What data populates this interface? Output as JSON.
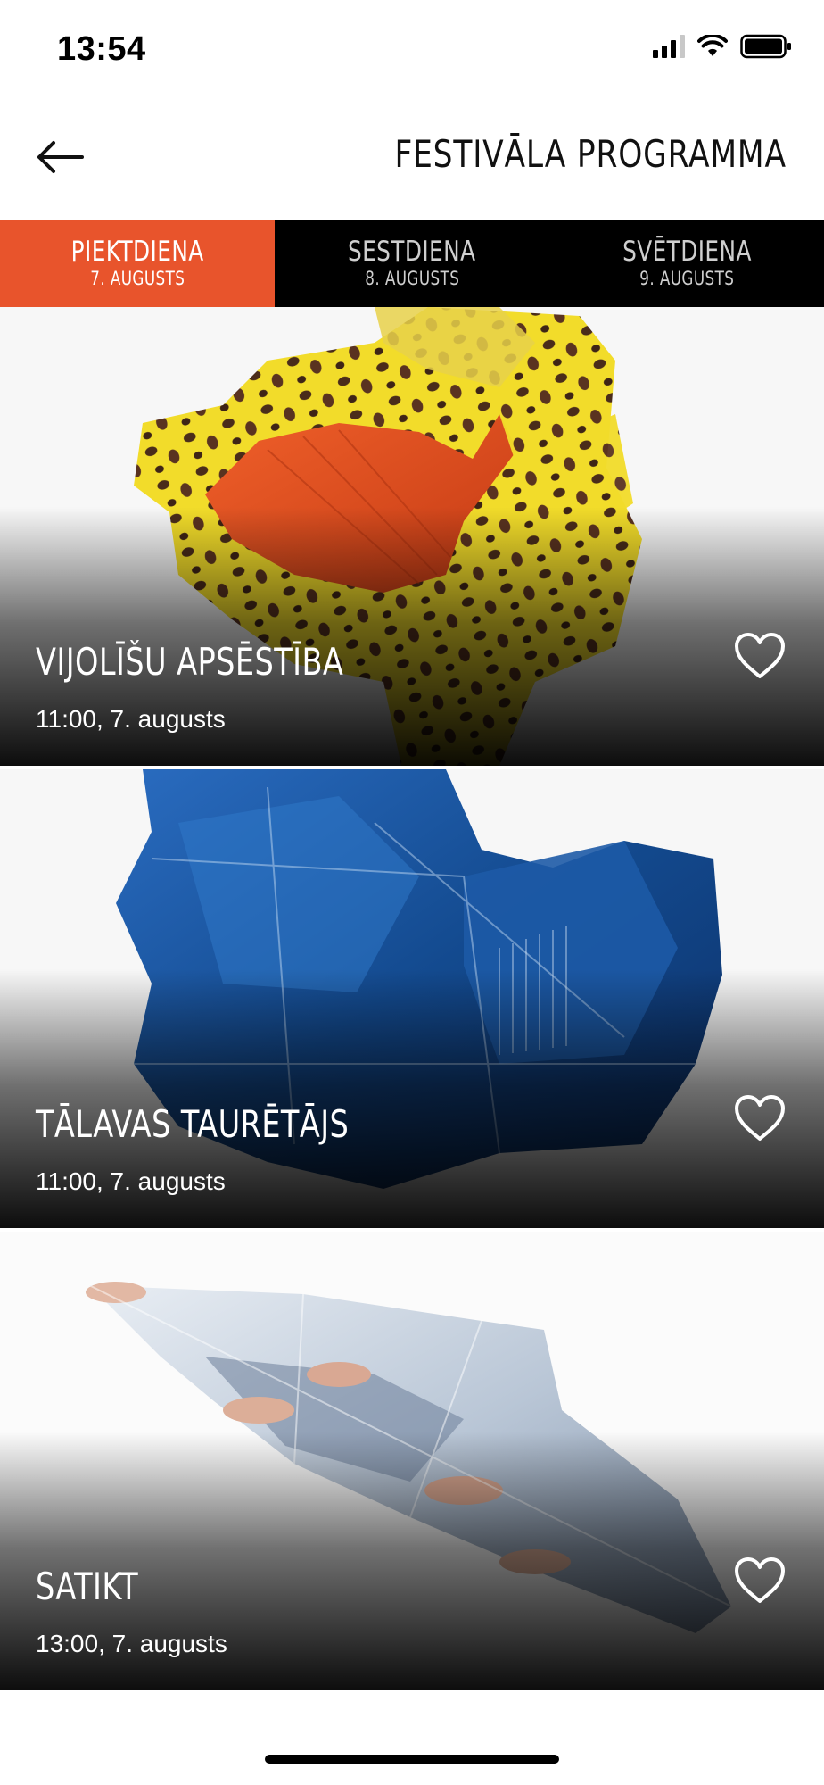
{
  "status_bar": {
    "time": "13:54"
  },
  "header": {
    "back_icon": "arrow-left-icon",
    "title": "FESTIVĀLA PROGRAMMA"
  },
  "tabs": [
    {
      "day": "PIEKTDIENA",
      "date": "7. AUGUSTS",
      "active": true
    },
    {
      "day": "SESTDIENA",
      "date": "8. AUGUSTS",
      "active": false
    },
    {
      "day": "SVĒTDIENA",
      "date": "9. AUGUSTS",
      "active": false
    }
  ],
  "events": [
    {
      "title": "VIJOLĪŠU APSĒSTĪBA",
      "time": "11:00, 7. augusts",
      "favorite_icon": "heart-outline-icon",
      "image": "crumpled yellow leopard-print paper"
    },
    {
      "title": "TĀLAVAS TAURĒTĀJS",
      "time": "11:00, 7. augusts",
      "favorite_icon": "heart-outline-icon",
      "image": "crumpled blue photo paper"
    },
    {
      "title": "SATIKT",
      "time": "13:00, 7. augusts",
      "favorite_icon": "heart-outline-icon",
      "image": "folded photo of hands"
    }
  ],
  "colors": {
    "accent": "#e8542c",
    "tab_bar": "#000000",
    "text_light": "#ffffff"
  }
}
